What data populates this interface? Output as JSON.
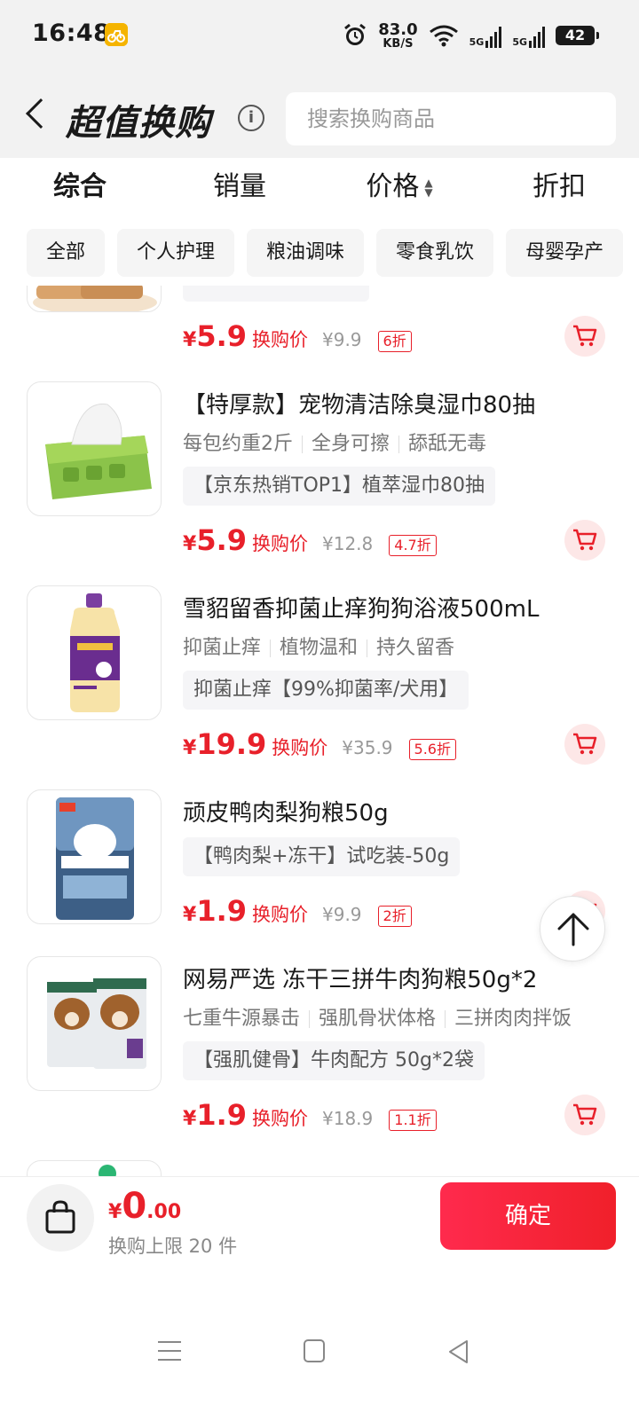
{
  "status_bar": {
    "time": "16:48",
    "app_badge": "ⓕ",
    "net_speed": "83.0",
    "net_unit": "KB/S",
    "sim1": "5G",
    "sim2": "5G",
    "battery": "42"
  },
  "header": {
    "title": "超值换购",
    "search_placeholder": "搜索换购商品"
  },
  "sort_tabs": [
    "综合",
    "销量",
    "价格",
    "折扣"
  ],
  "categories": [
    "全部",
    "个人护理",
    "粮油调味",
    "零食乳饮",
    "母婴孕产"
  ],
  "products": [
    {
      "price_int": "5.9",
      "price_label": "换购价",
      "orig_price": "¥9.9",
      "discount": "6折"
    },
    {
      "name": "【特厚款】宠物清洁除臭湿巾80抽",
      "tags": [
        "每包约重2斤",
        "全身可擦",
        "舔舐无毒"
      ],
      "promo": "【京东热销TOP1】植萃湿巾80抽",
      "price_int": "5.9",
      "price_label": "换购价",
      "orig_price": "¥12.8",
      "discount": "4.7折"
    },
    {
      "name": "雪貂留香抑菌止痒狗狗浴液500mL",
      "tags": [
        "抑菌止痒",
        "植物温和",
        "持久留香"
      ],
      "promo": "抑菌止痒【99%抑菌率/犬用】",
      "price_int": "19.9",
      "price_label": "换购价",
      "orig_price": "¥35.9",
      "discount": "5.6折"
    },
    {
      "name": "顽皮鸭肉梨狗粮50g",
      "promo": "【鸭肉梨+冻干】试吃装-50g",
      "price_int": "1.9",
      "price_label": "换购价",
      "orig_price": "¥9.9",
      "discount": "2折"
    },
    {
      "name": "网易严选 冻干三拼牛肉狗粮50g*2",
      "tags": [
        "七重牛源暴击",
        "强肌骨状体格",
        "三拼肉肉拌饭"
      ],
      "promo": "【强肌健骨】牛肉配方 50g*2袋",
      "price_int": "1.9",
      "price_label": "换购价",
      "orig_price": "¥18.9",
      "discount": "1.1折"
    }
  ],
  "currency": "¥",
  "bottom": {
    "total_int": "0",
    "total_dec": ".00",
    "limit_text": "换购上限 20 件",
    "confirm_label": "确定"
  },
  "colors": {
    "accent": "#e8202a",
    "bg_header": "#f2f2f2"
  }
}
